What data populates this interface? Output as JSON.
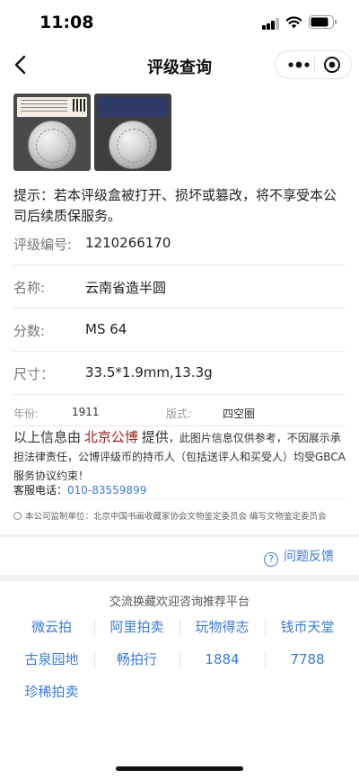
{
  "status_bar": {
    "time": "11:08"
  },
  "nav": {
    "title": "评级查询"
  },
  "notice": "提示：若本评级盒被打开、损坏或篡改，将不享受本公司后续质保服务。",
  "rows": [
    {
      "label": "评级编号:",
      "value": "1210266170"
    },
    {
      "label": "名称:",
      "value": "云南省造半圆"
    },
    {
      "label": "分数:",
      "value": "MS 64"
    },
    {
      "label": "尺寸：",
      "value": "33.5*1.9mm,13.3g"
    }
  ],
  "year": {
    "label": "年份:",
    "value": "1911"
  },
  "version": {
    "label": "版式:",
    "value": "四空圈"
  },
  "source": {
    "lead": "以上信息由",
    "brand": "北京公博",
    "provide": "提供",
    "text": "，此图片信息仅供参考，不因展示承担法律责任，公博评级币的持币人（包括送评人和买受人）均受GBCA服务协议约束！"
  },
  "service": {
    "label": "客服电话：",
    "phone": "010-83559899"
  },
  "supervise": "本公司监制单位：北京中国书画收藏家协会文物鉴定委员会  编写文物鉴定委员会",
  "feedback": {
    "label": "问题反馈"
  },
  "platforms": {
    "title": "交流换藏欢迎咨询推荐平台",
    "items": [
      "微云拍",
      "阿里拍卖",
      "玩物得志",
      "钱币天堂",
      "古泉园地",
      "畅拍行",
      "1884",
      "7788",
      "珍稀拍卖"
    ]
  }
}
